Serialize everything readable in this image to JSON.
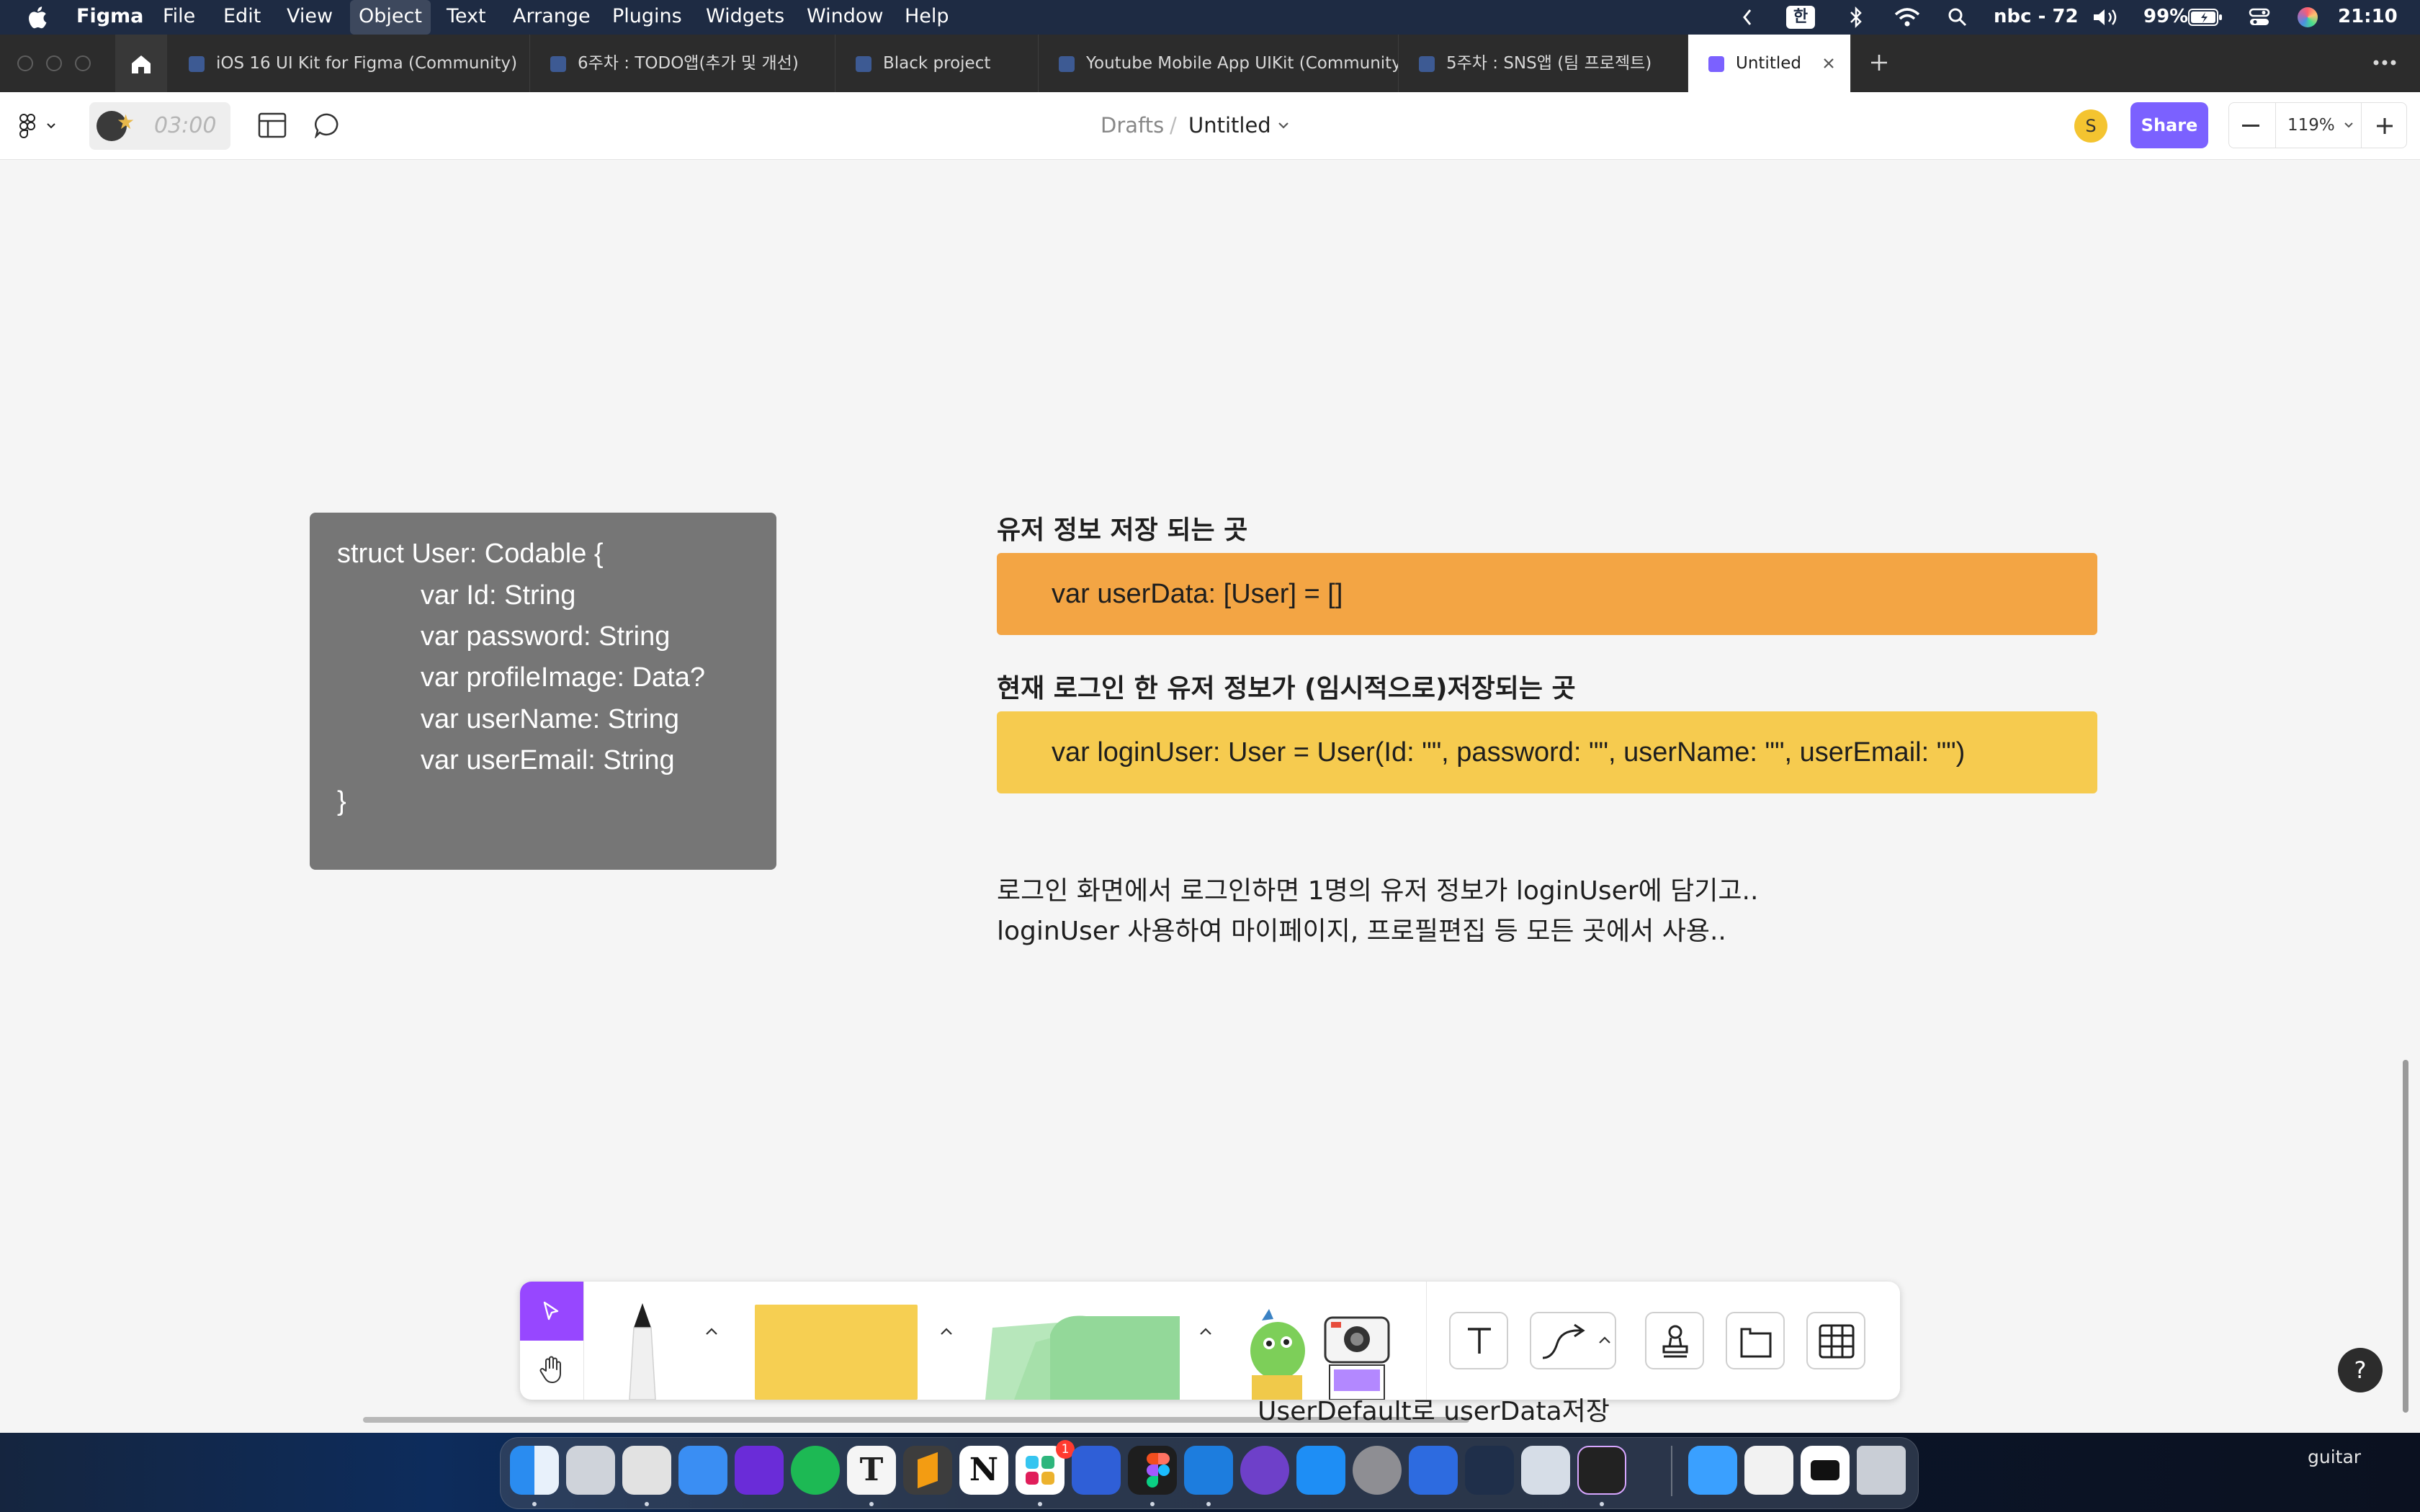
{
  "menubar": {
    "app_name": "Figma",
    "menus": [
      "File",
      "Edit",
      "View",
      "Object",
      "Text",
      "Arrange",
      "Plugins",
      "Widgets",
      "Window",
      "Help"
    ],
    "input_source": "한",
    "user_label": "nbc - 72",
    "battery": "99%",
    "clock": "21:10"
  },
  "tabs": [
    {
      "label": "iOS 16 UI Kit for Figma (Community)"
    },
    {
      "label": "6주차 : TODO앱(추가 및 개선)"
    },
    {
      "label": "Black project"
    },
    {
      "label": "Youtube Mobile App UIKit (Community)"
    },
    {
      "label": "5주차 : SNS앱 (팀 프로젝트)"
    },
    {
      "label": "Untitled",
      "active": true
    }
  ],
  "toolbar": {
    "timer": "03:00",
    "breadcrumb_parent": "Drafts",
    "breadcrumb_sep": "/",
    "file_name": "Untitled",
    "avatar_initial": "S",
    "share_label": "Share",
    "zoom": "119%"
  },
  "canvas": {
    "struct_card": {
      "lines": [
        "struct User: Codable {",
        "var Id: String",
        "var password: String",
        "var profileImage: Data?",
        "var userName: String",
        "var userEmail: String",
        "}"
      ]
    },
    "user_data_section": {
      "heading": "유저 정보 저장 되는 곳",
      "code": "var userData: [User] = []"
    },
    "login_user_section": {
      "heading": "현재 로그인 한 유저 정보가 (임시적으로)저장되는 곳",
      "code": "var loginUser: User = User(Id: \"\", password: \"\", userName: \"\", userEmail: \"\")"
    },
    "description": {
      "line1": "로그인 화면에서 로그인하면 1명의 유저 정보가 loginUser에 담기고..",
      "line2": "loginUser 사용하여 마이페이지, 프로필편집 등 모든 곳에서 사용.."
    },
    "tooltip": "UserDefault로 userData저장",
    "help_label": "?"
  },
  "colors": {
    "accent": "#7b61ff",
    "struct_card": "#767676",
    "orange_banner": "#f3a544",
    "yellow_banner": "#f6cb4f",
    "sticky_yellow": "#f6cf52",
    "sticky_green": "#9bdba0"
  },
  "dock": {
    "right_label": "guitar",
    "notification_badge": "1",
    "apps": [
      "finder-icon",
      "launchpad-icon",
      "photo-booth-icon",
      "mail-icon",
      "yahoo-finance-icon",
      "spotify-icon",
      "typora-icon",
      "sublime-icon",
      "notion-icon",
      "slack-icon",
      "react-icon",
      "figma-icon",
      "xcode-icon",
      "github-icon",
      "app-store-icon",
      "settings-icon",
      "instruments-icon",
      "dev-tool-icon",
      "preview-icon",
      "terminal-icon",
      "folder-icon",
      "file-icon",
      "youtube-icon",
      "trash-icon"
    ]
  }
}
